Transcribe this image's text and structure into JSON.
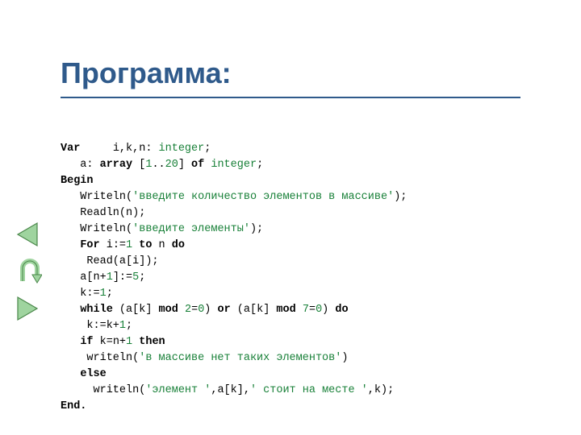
{
  "title": "Программа:",
  "code": {
    "l1": {
      "kw": "Var",
      "rest": "     i,k,n: ",
      "ty": "integer",
      "semi": ";"
    },
    "l2": {
      "pre": "   a: ",
      "kw": "array",
      "open": " [",
      "n1": "1",
      "dots": "..",
      "n2": "20",
      "close": "] ",
      "of": "of",
      "sp": " ",
      "ty": "integer",
      "semi": ";"
    },
    "l3": {
      "kw": "Begin"
    },
    "l4": {
      "pre": "   Writeln(",
      "s": "'введите количество элементов в массиве'",
      "post": ");"
    },
    "l5": {
      "txt": "   Readln(n);"
    },
    "l6": {
      "pre": "   Writeln(",
      "s": "'введите элементы'",
      "post": ");"
    },
    "l7": {
      "pre": "   ",
      "kw1": "For",
      "mid": " i:=",
      "n": "1",
      "sp": " ",
      "kw2": "to",
      "mid2": " n ",
      "kw3": "do"
    },
    "l8": {
      "txt": "    Read(a[i]);"
    },
    "l9": {
      "pre": "   a[n+",
      "n": "1",
      "mid": "]:=",
      "v": "5",
      "semi": ";"
    },
    "l10": {
      "pre": "   k:=",
      "n": "1",
      "semi": ";"
    },
    "l11": {
      "pre": "   ",
      "kw1": "while",
      "mid1": " (a[k] ",
      "kw2": "mod",
      "sp1": " ",
      "n1": "2",
      "eq1": "=",
      "z1": "0",
      "mid2": ") ",
      "kw3": "or",
      "mid3": " (a[k] ",
      "kw4": "mod",
      "sp2": " ",
      "n2": "7",
      "eq2": "=",
      "z2": "0",
      "mid4": ") ",
      "kw5": "do"
    },
    "l12": {
      "pre": "    k:=k+",
      "n": "1",
      "semi": ";"
    },
    "l13": {
      "pre": "   ",
      "kw1": "if",
      "mid": " k=n+",
      "n": "1",
      "sp": " ",
      "kw2": "then"
    },
    "l14": {
      "pre": "    writeln(",
      "s": "'в массиве нет таких элементов'",
      "post": ")"
    },
    "l15": {
      "pre": "   ",
      "kw": "else"
    },
    "l16": {
      "pre": "     writeln(",
      "s1": "'элемент '",
      "c1": ",a[k],",
      "s2": "' стоит на месте '",
      "c2": ",k);"
    },
    "l17": {
      "kw": "End."
    }
  },
  "nav": {
    "back": "back-button",
    "refresh": "refresh-button",
    "forward": "forward-button"
  }
}
